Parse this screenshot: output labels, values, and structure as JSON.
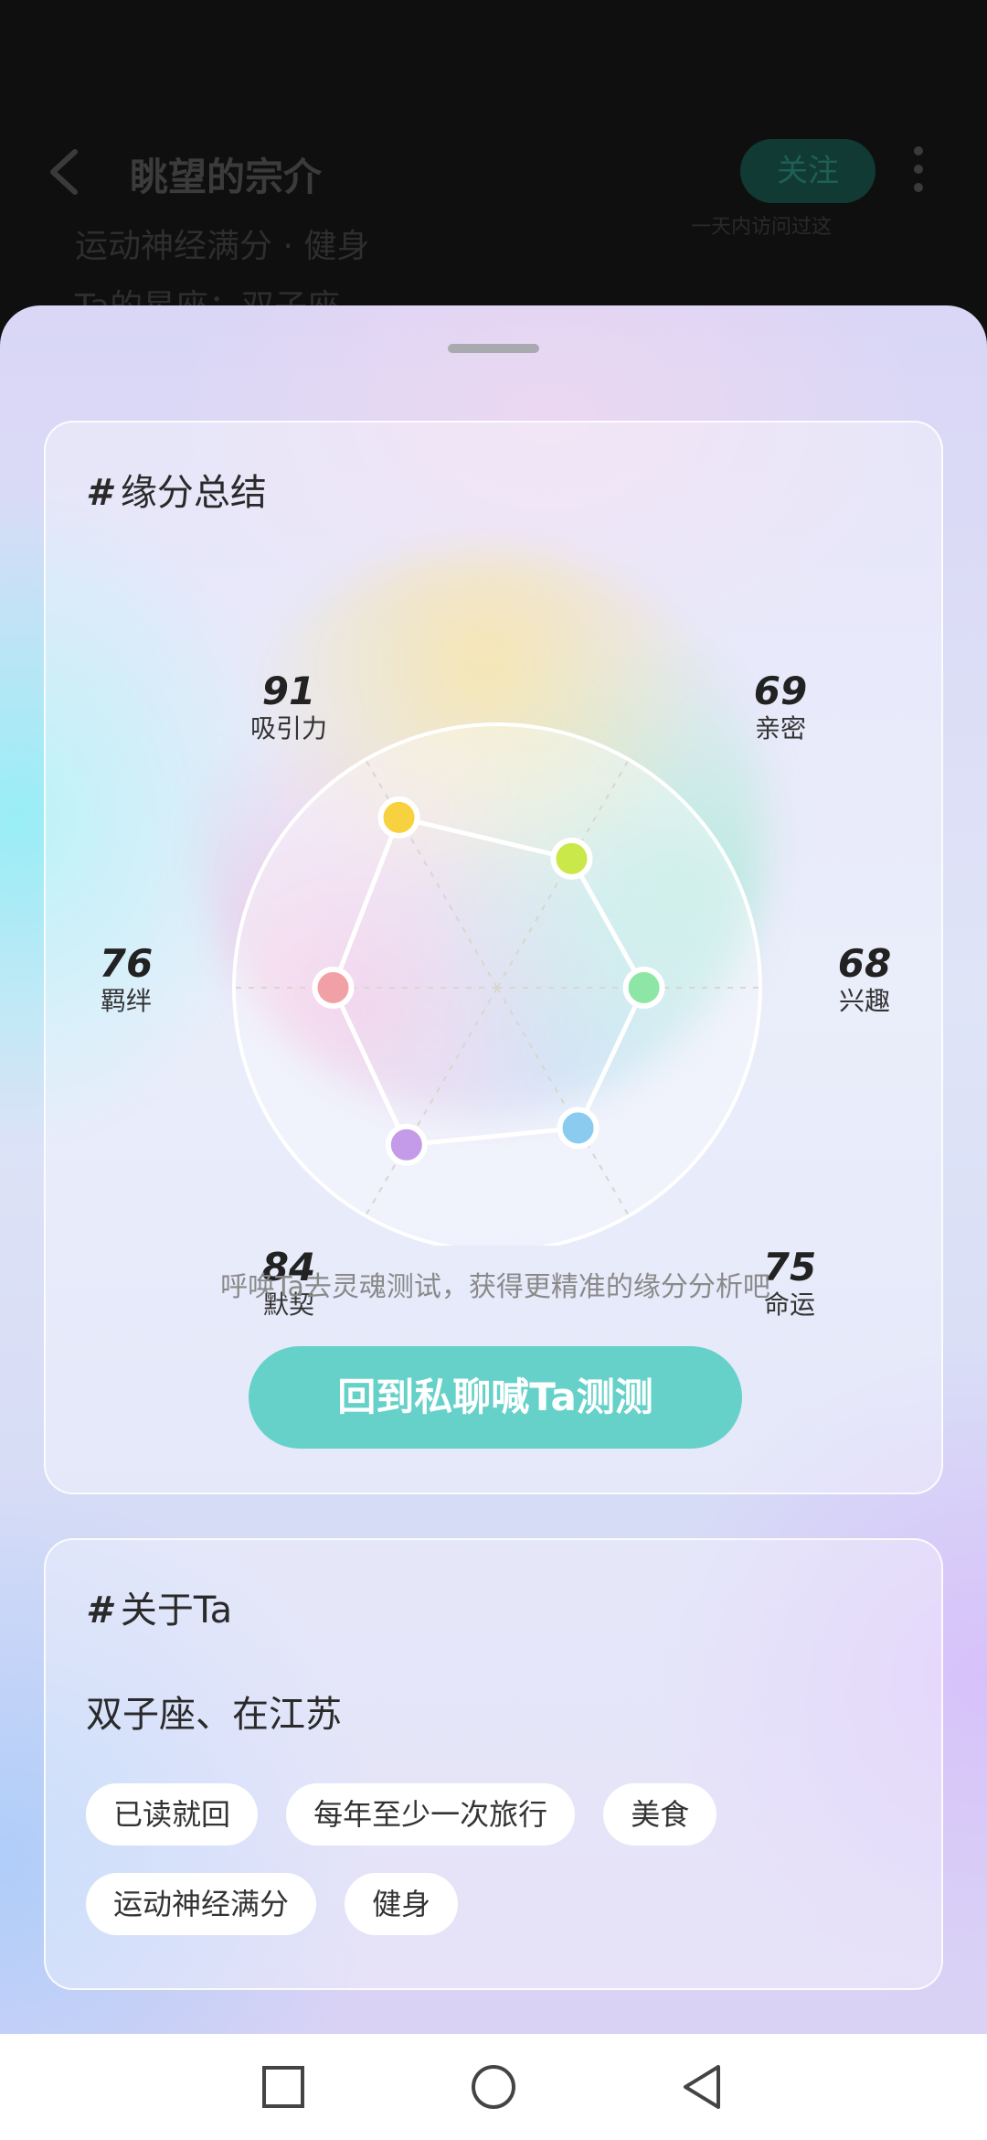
{
  "background_page": {
    "title": "眺望的宗介",
    "follow_label": "关注",
    "subtext": "一天内访问过这",
    "line1": "运动神经满分 · 健身",
    "line2": "Ta的星座：双子座"
  },
  "summary_card": {
    "hash": "#",
    "title": "缘分总结",
    "metrics": [
      {
        "label": "吸引力",
        "value": "91",
        "color": "#f7d23e"
      },
      {
        "label": "亲密",
        "value": "69",
        "color": "#cbe84a"
      },
      {
        "label": "兴趣",
        "value": "68",
        "color": "#8ee6a6"
      },
      {
        "label": "命运",
        "value": "75",
        "color": "#8ccbf0"
      },
      {
        "label": "默契",
        "value": "84",
        "color": "#c49be8"
      },
      {
        "label": "羁绊",
        "value": "76",
        "color": "#f1a1a5"
      }
    ],
    "hint": "呼唤Ta去灵魂测试，获得更精准的缘分分析吧",
    "cta_label": "回到私聊喊Ta测测"
  },
  "about_card": {
    "hash": "#",
    "title": "关于Ta",
    "summary": "双子座、在江苏",
    "tags": [
      "已读就回",
      "每年至少一次旅行",
      "美食",
      "运动神经满分",
      "健身"
    ]
  },
  "accent_color": "#66d1c9"
}
